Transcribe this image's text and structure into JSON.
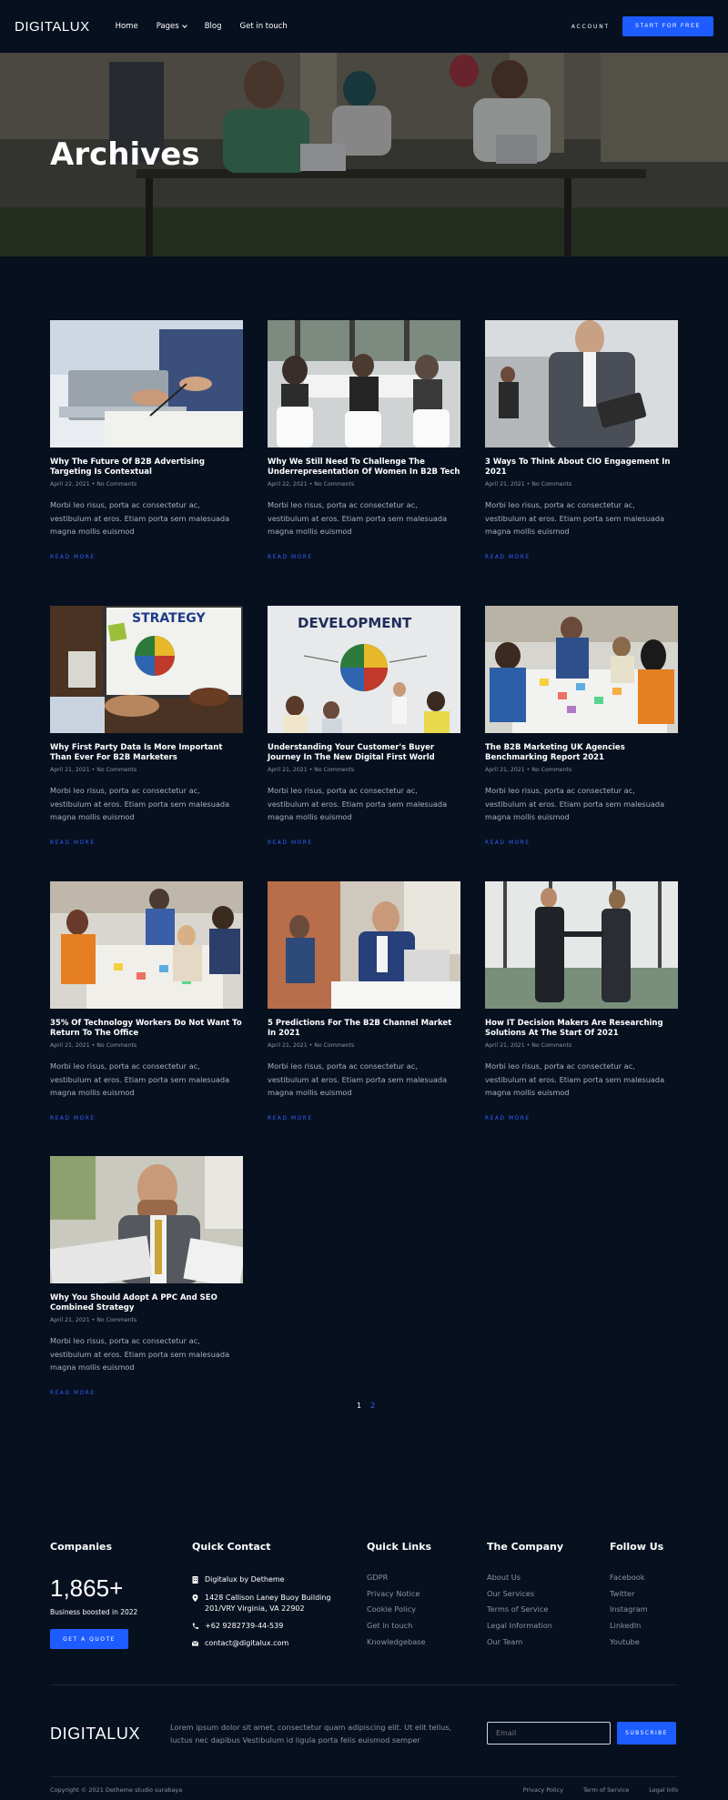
{
  "nav": {
    "logo": "DIGITALUX",
    "links": [
      "Home",
      "Pages",
      "Blog",
      "Get in touch"
    ],
    "account": "ACCOUNT",
    "cta": "START FOR FREE"
  },
  "hero": {
    "title": "Archives"
  },
  "posts": [
    {
      "title": "Why The Future Of B2B Advertising Targeting Is Contextual",
      "meta": "April 22, 2021 • No Comments",
      "excerpt": "Morbi leo risus, porta ac consectetur ac, vestibulum at eros. Etiam porta sem malesuada magna mollis euismod",
      "read_more": "READ MORE"
    },
    {
      "title": "Why We Still Need To Challenge The Underrepresentation Of Women In B2B Tech",
      "meta": "April 22, 2021 • No Comments",
      "excerpt": "Morbi leo risus, porta ac consectetur ac, vestibulum at eros. Etiam porta sem malesuada magna mollis euismod",
      "read_more": "READ MORE"
    },
    {
      "title": "3 Ways To Think About CIO Engagement In 2021",
      "meta": "April 21, 2021 • No Comments",
      "excerpt": "Morbi leo risus, porta ac consectetur ac, vestibulum at eros. Etiam porta sem malesuada magna mollis euismod",
      "read_more": "READ MORE"
    },
    {
      "title": "Why First Party Data Is More Important Than Ever For B2B Marketers",
      "meta": "April 21, 2021 • No Comments",
      "excerpt": "Morbi leo risus, porta ac consectetur ac, vestibulum at eros. Etiam porta sem malesuada magna mollis euismod",
      "read_more": "READ MORE"
    },
    {
      "title": "Understanding Your Customer's Buyer Journey In The New Digital First World",
      "meta": "April 21, 2021 • No Comments",
      "excerpt": "Morbi leo risus, porta ac consectetur ac, vestibulum at eros. Etiam porta sem malesuada magna mollis euismod",
      "read_more": "READ MORE"
    },
    {
      "title": "The B2B Marketing UK Agencies Benchmarking Report 2021",
      "meta": "April 21, 2021 • No Comments",
      "excerpt": "Morbi leo risus, porta ac consectetur ac, vestibulum at eros. Etiam porta sem malesuada magna mollis euismod",
      "read_more": "READ MORE"
    },
    {
      "title": "35% Of Technology Workers Do Not Want To Return To The Office",
      "meta": "April 21, 2021 • No Comments",
      "excerpt": "Morbi leo risus, porta ac consectetur ac, vestibulum at eros. Etiam porta sem malesuada magna mollis euismod",
      "read_more": "READ MORE"
    },
    {
      "title": "5 Predictions For The B2B Channel Market In 2021",
      "meta": "April 21, 2021 • No Comments",
      "excerpt": "Morbi leo risus, porta ac consectetur ac, vestibulum at eros. Etiam porta sem malesuada magna mollis euismod",
      "read_more": "READ MORE"
    },
    {
      "title": "How IT Decision Makers Are Researching Solutions At The Start Of 2021",
      "meta": "April 21, 2021 • No Comments",
      "excerpt": "Morbi leo risus, porta ac consectetur ac, vestibulum at eros. Etiam porta sem malesuada magna mollis euismod",
      "read_more": "READ MORE"
    },
    {
      "title": "Why You Should Adopt A PPC And SEO Combined Strategy",
      "meta": "April 21, 2021 • No Comments",
      "excerpt": "Morbi leo risus, porta ac consectetur ac, vestibulum at eros. Etiam porta sem malesuada magna mollis euismod",
      "read_more": "READ MORE"
    }
  ],
  "post_images": [
    {
      "text": ""
    },
    {
      "text": ""
    },
    {
      "text": ""
    },
    {
      "text": "STRATEGY"
    },
    {
      "text": "DEVELOPMENT"
    },
    {
      "text": ""
    },
    {
      "text": ""
    },
    {
      "text": ""
    },
    {
      "text": ""
    },
    {
      "text": ""
    }
  ],
  "pagination": {
    "current": "1",
    "next": "2"
  },
  "footer": {
    "companies": {
      "heading": "Companies",
      "number": "1,865+",
      "caption": "Business boosted in 2022",
      "button": "GET A QUOTE"
    },
    "quick_contact": {
      "heading": "Quick Contact",
      "company": "Digitalux by Detheme",
      "address_line1": "1428 Callison Laney Buoy Building",
      "address_line2": "201/VRY Virginia, VA 22902",
      "phone": "+62 9282739-44-539",
      "email": "contact@digitalux.com"
    },
    "quick_links": {
      "heading": "Quick Links",
      "items": [
        "GDPR",
        "Privacy Notice",
        "Cookie Policy",
        "Get in touch",
        "Knowledgebase"
      ]
    },
    "the_company": {
      "heading": "The Company",
      "items": [
        "About Us",
        "Our Services",
        "Terms of Service",
        "Legal Information",
        "Our Team"
      ]
    },
    "follow_us": {
      "heading": "Follow Us",
      "items": [
        "Facebook",
        "Twitter",
        "Instagram",
        "LinkedIn",
        "Youtube"
      ]
    },
    "logo": "DIGITALUX",
    "description": "Lorem ipsum dolor sit amet, consectetur quam adipiscing elit. Ut elit tellus, luctus nec dapibus Vestibulum id ligula porta felis euismod semper",
    "email_placeholder": "Email",
    "subscribe": "SUBSCRIBE",
    "copyright": "Copyright © 2021 Detheme studio surabaya",
    "legal": [
      "Privacy Policy",
      "Term of Service",
      "Legal Info"
    ]
  },
  "colors": {
    "background": "#07101f",
    "accent": "#1d5cff",
    "link": "#2e62ff"
  }
}
